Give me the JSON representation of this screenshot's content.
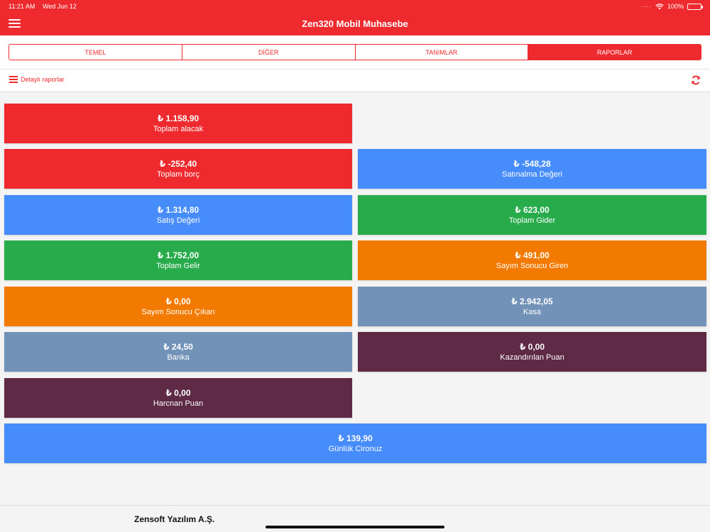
{
  "status": {
    "time": "11:21 AM",
    "date": "Wed Jun 12",
    "battery": "100%"
  },
  "header": {
    "title": "Zen320 Mobil Muhasebe"
  },
  "tabs": [
    {
      "label": "TEMEL",
      "active": false
    },
    {
      "label": "DİĞER",
      "active": false
    },
    {
      "label": "TANIMLAR",
      "active": false
    },
    {
      "label": "RAPORLAR",
      "active": true
    }
  ],
  "toolbar": {
    "detail_label": "Detaylı raporlar"
  },
  "colors": {
    "red": "#ee2a2e",
    "blue": "#478cfb",
    "green": "#27ab4b",
    "orange": "#f27a00",
    "slate": "#7392b8",
    "maroon": "#5e2a45"
  },
  "cards": [
    {
      "value": "₺ 1.158,90",
      "label": "Toplam alacak",
      "color": "red"
    },
    {
      "value": "₺ -252,40",
      "label": "Toplam borç",
      "color": "red"
    },
    {
      "value": "₺ -548,28",
      "label": "Satınalma Değeri",
      "color": "blue"
    },
    {
      "value": "₺ 1.314,80",
      "label": "Satış Değeri",
      "color": "blue"
    },
    {
      "value": "₺ 623,00",
      "label": "Toplam Gider",
      "color": "green"
    },
    {
      "value": "₺ 1.752,00",
      "label": "Toplam Gelir",
      "color": "green"
    },
    {
      "value": "₺ 491,00",
      "label": "Sayım Sonucu Giren",
      "color": "orange"
    },
    {
      "value": "₺ 0,00",
      "label": "Sayım Sonucu Çıkan",
      "color": "orange"
    },
    {
      "value": "₺ 2.942,05",
      "label": "Kasa",
      "color": "slate"
    },
    {
      "value": "₺ 24,50",
      "label": "Banka",
      "color": "slate"
    },
    {
      "value": "₺ 0,00",
      "label": "Kazandırılan Puan",
      "color": "maroon"
    },
    {
      "value": "₺ 0,00",
      "label": "Harcnan Puan",
      "color": "maroon"
    },
    {
      "value": "₺ 139,90",
      "label": "Günlük Cironuz",
      "color": "blue"
    }
  ],
  "footer": {
    "company": "Zensoft Yazılım A.Ş."
  }
}
